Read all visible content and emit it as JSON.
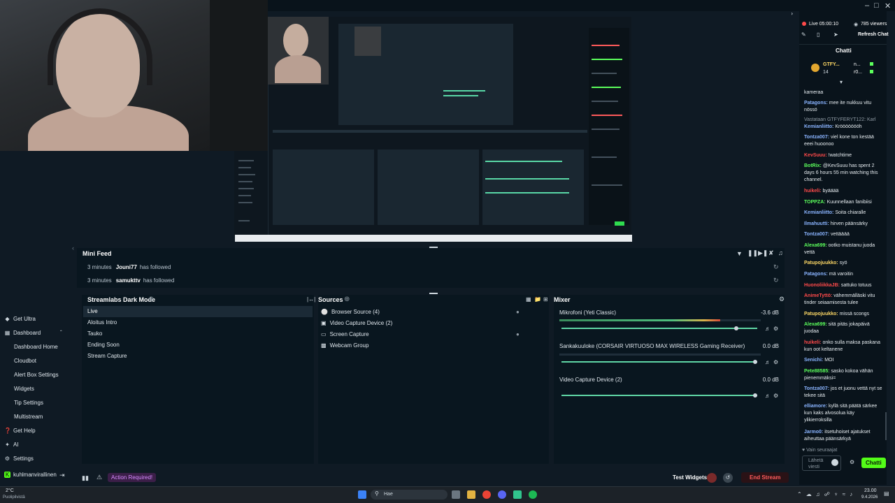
{
  "webcam_overlay": {
    "alt": "Webcam"
  },
  "chat": {
    "live_label": "Live 05:00:10",
    "viewers": "785 viewers",
    "refresh_label": "Refresh Chat",
    "title": "Chatti",
    "pinned_user": "GTFY...",
    "pinned_count": "14",
    "pinned_r1": "n...",
    "pinned_r2": "r0...",
    "followers_only": "Vain seuraajat",
    "input_placeholder": "Lähetä viesti",
    "send_label": "Chatti",
    "messages": [
      {
        "user": "",
        "text": "kameraa",
        "color": "#e6ecf0"
      },
      {
        "user": "Patagons:",
        "text": "mee ite nukkuu vitu nössö",
        "color": "#8ab4ff"
      },
      {
        "user": "Vastataan GTFYFERYT122: Karl",
        "text": "",
        "color": "#8f9aa3"
      },
      {
        "user": "Kemianliitto:",
        "text": "Kröööööööh",
        "color": "#8ab4ff"
      },
      {
        "user": "Tontza007:",
        "text": "viel kone ton kestää eeei huoonoo",
        "color": "#8ab4ff"
      },
      {
        "user": "KevSuuu:",
        "text": "!watchtime",
        "color": "#ff4a4a"
      },
      {
        "user": "BotRix:",
        "text": "@KevSuuu has spent 2 days 6 hours 55 min watching this channel.",
        "color": "#5cff5c"
      },
      {
        "user": "huikeli:",
        "text": "byääää",
        "color": "#ff4a4a"
      },
      {
        "user": "TOPPZA:",
        "text": "Kuunnellaan fanibiisi",
        "color": "#5cff5c"
      },
      {
        "user": "Kemianliitto:",
        "text": "Soita chiaralle",
        "color": "#8ab4ff"
      },
      {
        "user": "Ilmahuutti:",
        "text": "hirven päänsärky",
        "color": "#8ab4ff"
      },
      {
        "user": "Tontza007:",
        "text": "vettääää",
        "color": "#8ab4ff"
      },
      {
        "user": "Alexa699:",
        "text": "ootko muistanu juoda vettä",
        "color": "#5cff5c"
      },
      {
        "user": "Patupojuukko:",
        "text": "syö",
        "color": "#ffd966"
      },
      {
        "user": "Patagons:",
        "text": "mä varoitin",
        "color": "#8ab4ff"
      },
      {
        "user": "HuonoliikkaJB:",
        "text": "sattuko totuus",
        "color": "#ff4a4a"
      },
      {
        "user": "AnimeTyttö:",
        "text": "vähemmälläski vitu tinder seiaamisesta tulee",
        "color": "#ff4a4a"
      },
      {
        "user": "Patupojuukko:",
        "text": "missä scongs",
        "color": "#ffd966"
      },
      {
        "user": "Alexa699:",
        "text": "sitä pitäs jokapäivä juodaa",
        "color": "#5cff5c"
      },
      {
        "user": "huikeli:",
        "text": "onko sulla maksa paskana kun oot keltanene",
        "color": "#ff4a4a"
      },
      {
        "user": "Senichi:",
        "text": "MOI",
        "color": "#8ab4ff"
      },
      {
        "user": "Pete88585:",
        "text": "sasko kokoa vähän pienemmäksi=",
        "color": "#5cff5c"
      },
      {
        "user": "Tontza007:",
        "text": "jos et juonu vettä nyt se tekee sitä",
        "color": "#8ab4ff"
      },
      {
        "user": "elliamore:",
        "text": "kyllä sitä päätä särkee kun kaks alvosolua käy ylikierroksilla",
        "color": "#8ab4ff"
      },
      {
        "user": "Jarmo0:",
        "text": "itsetuhoiset ajatukset aiheuttaa päänsärkyä",
        "color": "#8ab4ff"
      }
    ]
  },
  "sidebar": {
    "items": [
      {
        "label": "Get Ultra",
        "icon": "ultra-icon"
      },
      {
        "label": "Dashboard",
        "icon": "dashboard-icon"
      },
      {
        "label": "Dashboard Home"
      },
      {
        "label": "Cloudbot"
      },
      {
        "label": "Alert Box Settings"
      },
      {
        "label": "Widgets"
      },
      {
        "label": "Tip Settings"
      },
      {
        "label": "Multistream"
      },
      {
        "label": "Get Help",
        "icon": "help-icon"
      },
      {
        "label": "AI",
        "icon": "ai-icon"
      },
      {
        "label": "Settings",
        "icon": "gear-icon"
      },
      {
        "label": "kuhlmanvirallinen",
        "icon": "kick-icon"
      }
    ]
  },
  "mini_feed": {
    "title": "Mini Feed",
    "rows": [
      {
        "time": "3 minutes",
        "user": "Jouni77",
        "action": "has followed"
      },
      {
        "time": "3 minutes",
        "user": "samukttv",
        "action": "has followed"
      }
    ]
  },
  "scenes": {
    "title": "Streamlabs Dark Mode",
    "items": [
      "Live",
      "Aloitus Intro",
      "Tauko",
      "Ending Soon",
      "Stream Capture"
    ]
  },
  "sources": {
    "title": "Sources",
    "items": [
      "Browser Source (4)",
      "Video Capture Device (2)",
      "Screen Capture",
      "Webcam Group"
    ]
  },
  "mixer": {
    "title": "Mixer",
    "channels": [
      {
        "name": "Mikrofoni (Yeti Classic)",
        "db": "-3.6 dB",
        "level": 0.91
      },
      {
        "name": "Sankakuuloke (CORSAIR VIRTUOSO MAX WIRELESS Gaming Receiver)",
        "db": "0.0 dB",
        "level": 1.0
      },
      {
        "name": "Video Capture Device (2)",
        "db": "0.0 dB",
        "level": 1.0
      }
    ]
  },
  "footer": {
    "action_required": "Action Required!",
    "test_widgets": "Test Widgets",
    "end_stream": "End Stream"
  },
  "taskbar": {
    "weather_temp": "2°C",
    "weather_desc": "Puolipilvistä",
    "search_placeholder": "Hae",
    "time": "23.00",
    "date": "9.4.2026"
  }
}
